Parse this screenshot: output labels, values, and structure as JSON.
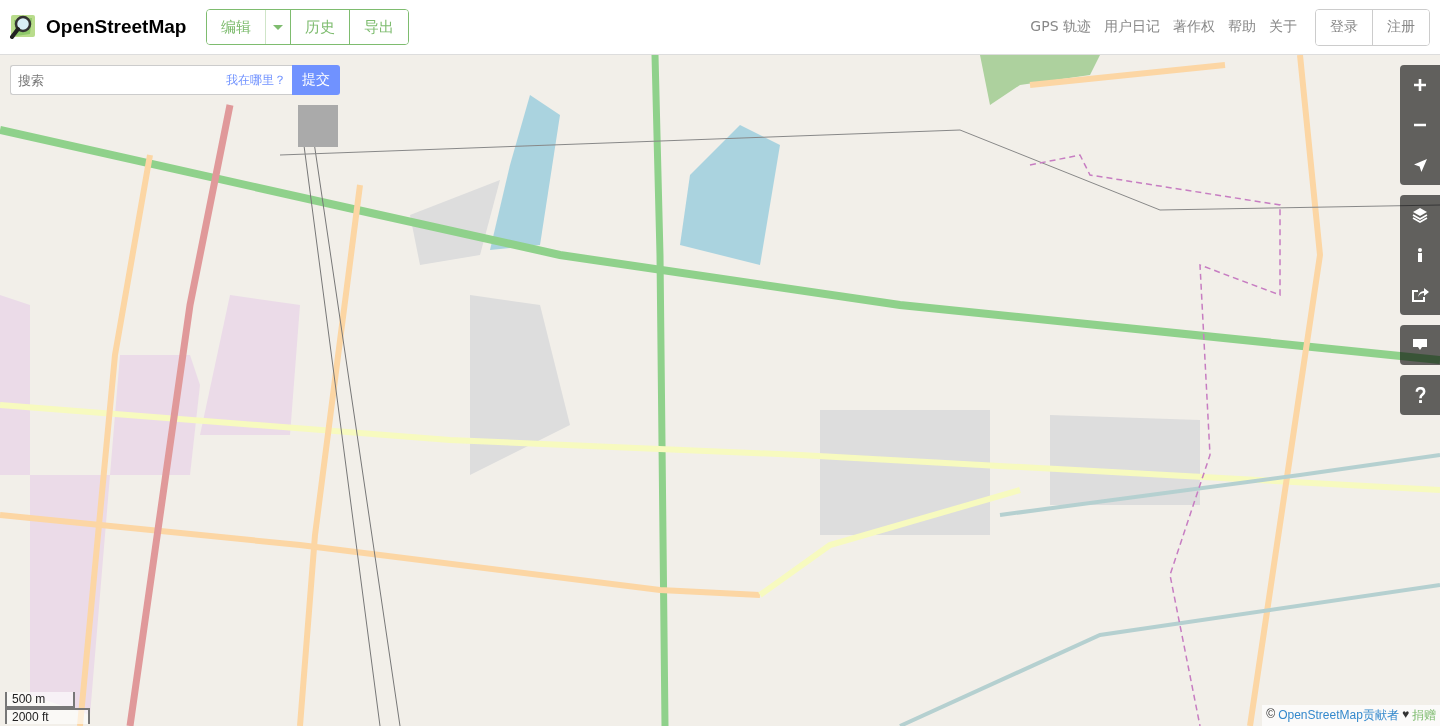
{
  "header": {
    "logo_text": "OpenStreetMap",
    "edit_buttons": [
      {
        "label": "编辑",
        "kind": "dropdown"
      },
      {
        "label": "历史",
        "kind": "plain"
      },
      {
        "label": "导出",
        "kind": "plain"
      }
    ],
    "nav_links": [
      "GPS 轨迹",
      "用户日记",
      "著作权",
      "帮助",
      "关于"
    ],
    "account_buttons": [
      "登录",
      "注册"
    ]
  },
  "search": {
    "placeholder": "搜索",
    "where_am_i": "我在哪里？",
    "submit": "提交"
  },
  "scale": {
    "metric": "500 m",
    "imperial": "2000 ft"
  },
  "attribution": {
    "prefix": "©",
    "link": "OpenStreetMap贡献者",
    "heart": "♥",
    "donate": "捐赠"
  }
}
